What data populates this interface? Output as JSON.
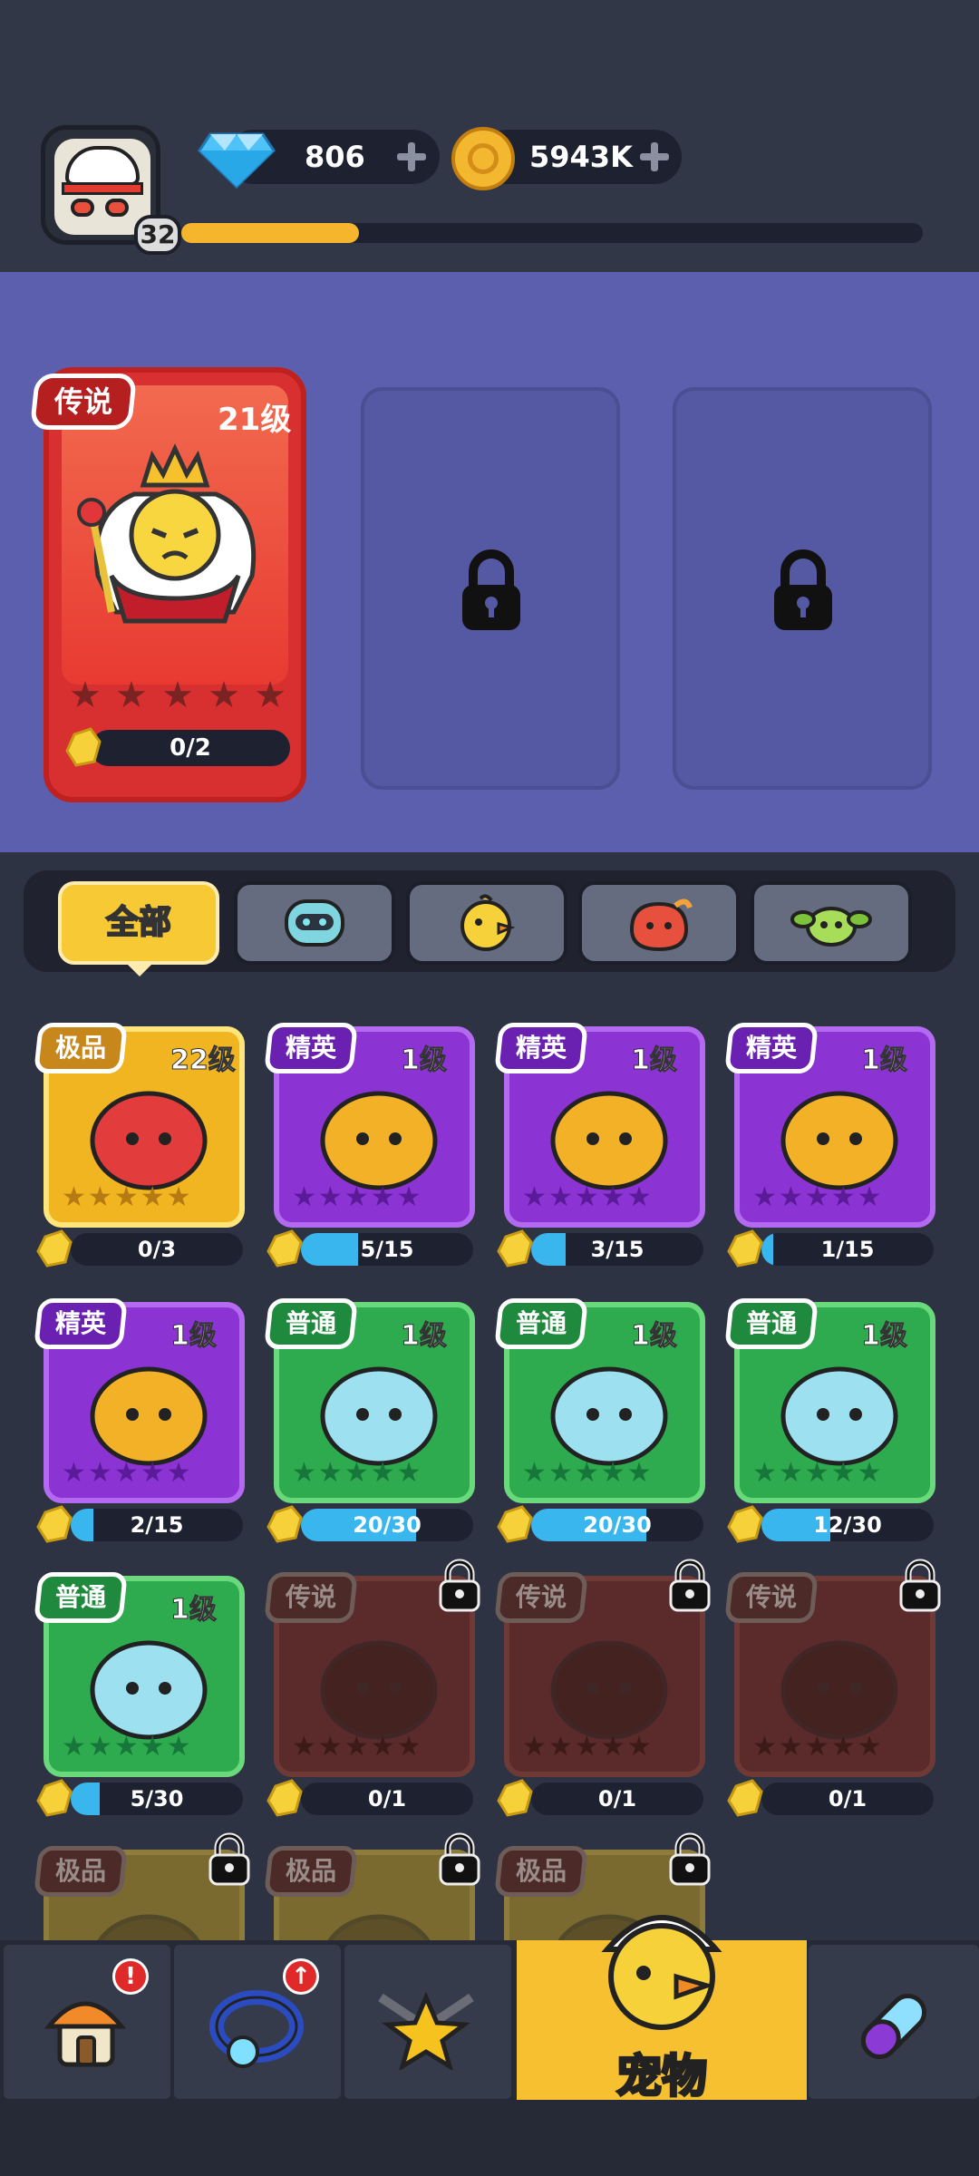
{
  "header": {
    "player_level": "32",
    "xp_progress": 0.24,
    "gems": "806",
    "coins": "5943K"
  },
  "featured_pet": {
    "rarity": "传说",
    "level": "21级",
    "stars_filled": 0,
    "stars_total": 5,
    "shards": "0/2"
  },
  "tabs": [
    {
      "label": "全部",
      "icon": "all",
      "active": true
    },
    {
      "label": "",
      "icon": "robot-icon"
    },
    {
      "label": "",
      "icon": "chick-icon"
    },
    {
      "label": "",
      "icon": "flame-creature-icon"
    },
    {
      "label": "",
      "icon": "plant-creature-icon"
    }
  ],
  "pets": [
    {
      "rarity": "极品",
      "level": "22级",
      "shards": "0/3",
      "fill": 0.0,
      "kind": "legendary",
      "locked": false
    },
    {
      "rarity": "精英",
      "level": "1级",
      "shards": "5/15",
      "fill": 0.33,
      "kind": "elite",
      "locked": false
    },
    {
      "rarity": "精英",
      "level": "1级",
      "shards": "3/15",
      "fill": 0.2,
      "kind": "elite",
      "locked": false
    },
    {
      "rarity": "精英",
      "level": "1级",
      "shards": "1/15",
      "fill": 0.07,
      "kind": "elite",
      "locked": false
    },
    {
      "rarity": "精英",
      "level": "1级",
      "shards": "2/15",
      "fill": 0.13,
      "kind": "elite",
      "locked": false
    },
    {
      "rarity": "普通",
      "level": "1级",
      "shards": "20/30",
      "fill": 0.67,
      "kind": "common",
      "locked": false
    },
    {
      "rarity": "普通",
      "level": "1级",
      "shards": "20/30",
      "fill": 0.67,
      "kind": "common",
      "locked": false
    },
    {
      "rarity": "普通",
      "level": "1级",
      "shards": "12/30",
      "fill": 0.4,
      "kind": "common",
      "locked": false
    },
    {
      "rarity": "普通",
      "level": "1级",
      "shards": "5/30",
      "fill": 0.17,
      "kind": "common",
      "locked": false
    },
    {
      "rarity": "传说",
      "level": "",
      "shards": "0/1",
      "fill": 0.0,
      "kind": "locked",
      "locked": true
    },
    {
      "rarity": "传说",
      "level": "",
      "shards": "0/1",
      "fill": 0.0,
      "kind": "locked",
      "locked": true
    },
    {
      "rarity": "传说",
      "level": "",
      "shards": "0/1",
      "fill": 0.0,
      "kind": "locked",
      "locked": true
    },
    {
      "rarity": "极品",
      "level": "",
      "shards": "",
      "fill": 0.0,
      "kind": "lockedgold",
      "locked": true
    },
    {
      "rarity": "极品",
      "level": "",
      "shards": "",
      "fill": 0.0,
      "kind": "lockedgold",
      "locked": true
    },
    {
      "rarity": "极品",
      "level": "",
      "shards": "",
      "fill": 0.0,
      "kind": "lockedgold",
      "locked": true
    }
  ],
  "nav": {
    "shop_alert": "!",
    "equip_alert": "↑",
    "active_label": "宠物"
  },
  "colors": {
    "gold": "#f7c030",
    "elite": "#8b34d3",
    "common": "#2fab4f",
    "legendary_red": "#d83030"
  }
}
